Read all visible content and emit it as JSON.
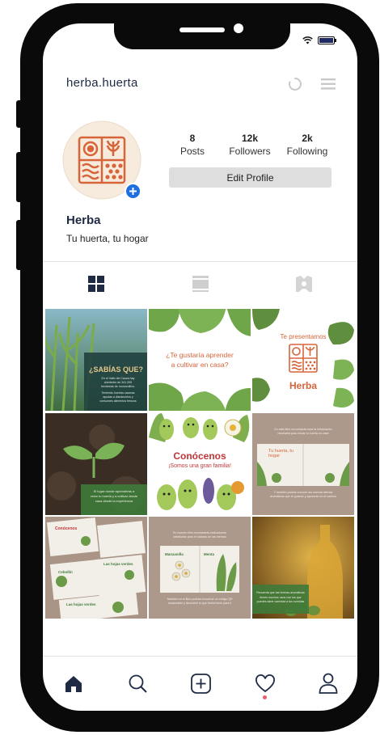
{
  "profile": {
    "username": "herba.huerta",
    "name": "Herba",
    "bio": "Tu huerta, tu hogar",
    "stats": [
      {
        "value": "8",
        "label": "Posts"
      },
      {
        "value": "12k",
        "label": "Followers"
      },
      {
        "value": "2k",
        "label": "Following"
      }
    ],
    "edit_label": "Edit Profile",
    "logo_text": "Herba"
  },
  "icons": {
    "header": [
      "loading-spinner-icon",
      "menu-icon"
    ],
    "status": [
      "wifi-icon",
      "battery-icon"
    ],
    "tabs": [
      "grid-icon",
      "feed-icon",
      "tagged-icon"
    ],
    "bottom_nav": [
      "home-icon",
      "search-icon",
      "add-post-icon",
      "activity-heart-icon",
      "profile-icon"
    ]
  },
  "colors": {
    "brand_orange": "#d8643a",
    "brand_green": "#5f8f3e",
    "accent_blue": "#1e6fe0",
    "notification_dot": "#ef5b6b"
  },
  "posts": [
    {
      "title": "¿SABÍAS QUE?",
      "lines": [
        "En el Valle del Cauca hay",
        "alrededor de 341.205",
        "hectáreas de monocultivo.",
        "Teniendo huertas caseras",
        "ayudas a disminuirlos y",
        "consumes alimentos frescos"
      ]
    },
    {
      "title": "¿Te gustaría aprender",
      "subtitle": "a cultivar en casa?"
    },
    {
      "title": "Te presentamos",
      "brand": "Herba"
    },
    {
      "lines": [
        "El lugar donde aprenderás a",
        "crear tu huerta y a cultivar desde",
        "casa desde la experiencia"
      ]
    },
    {
      "title": "Conócenos",
      "subtitle": "¡Somos una gran familia!"
    },
    {
      "lines_top": [
        "En este libro encontrarás toda la información",
        "necesaria para iniciar tu huerta en casa"
      ],
      "book_title": "Tu huerta, tu hogar",
      "lines_bottom": [
        "Y también podrás conocer las nuevas hierbas",
        "aromáticas que te guiarán y ayudarán en el camino"
      ]
    },
    {
      "pages": [
        "Conócenos",
        "Cebollín",
        "Las hojas verdes",
        "Las hojas verdes"
      ]
    },
    {
      "lines_top": [
        "En nuestro libro encontrarás indicaciones",
        "detalladas para el cuidado de las hierbas"
      ],
      "pages": [
        "Manzanilla",
        "Menta"
      ],
      "lines_bottom": [
        "También en el libro podrás encontrar un código QR",
        "escaneable y descubrir lo que Herba tiene para ti"
      ]
    },
    {
      "lines": [
        "Recuerda que las hierbas aromáticas",
        "tienen muchos usos con los que",
        "puedes darle variedad a tus comidas"
      ]
    }
  ]
}
